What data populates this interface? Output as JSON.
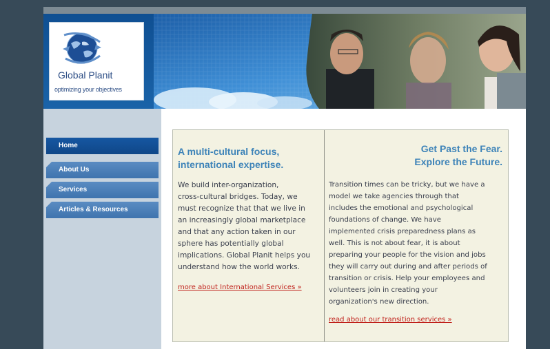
{
  "logo": {
    "name": "Global Planit",
    "tagline": "optimizing your objectives"
  },
  "nav": {
    "items": [
      {
        "label": "Home",
        "active": true
      },
      {
        "label": "About Us",
        "active": false
      },
      {
        "label": "Services",
        "active": false
      },
      {
        "label": "Articles & Resources",
        "active": false
      }
    ]
  },
  "left_column": {
    "heading_line1": "A multi-cultural focus,",
    "heading_line2": "international expertise.",
    "body_lines": [
      "We build inter-organization,",
      "cross-cultural bridges. Today, we",
      "must recognize that that we live in",
      "an increasingly global marketplace",
      "and that any action taken in our",
      "sphere has potentially global",
      "implications. Global Planit helps you",
      "understand how the world works."
    ],
    "link": "more about International Services »"
  },
  "right_column": {
    "heading_line1": "Get Past the Fear.",
    "heading_line2": "Explore the Future.",
    "body_lines": [
      "Transition times can be tricky, but we have a",
      "model we take agencies through that",
      "includes the emotional and psychological",
      "foundations of change. We have",
      "implemented crisis preparedness plans as",
      "well. This is not about fear, it is about",
      "preparing your people for the vision and jobs",
      "they will carry out during and after periods of",
      "transition or crisis. Help your employees and",
      "volunteers join in creating your",
      "organization's new direction."
    ],
    "link": "read about our transition services »"
  },
  "colors": {
    "page_bg": "#374a58",
    "nav_active": "#0f4788",
    "nav_normal": "#4a7fb8",
    "heading": "#3d83b8",
    "link": "#c0201a",
    "content_bg": "#f3f2e2"
  }
}
